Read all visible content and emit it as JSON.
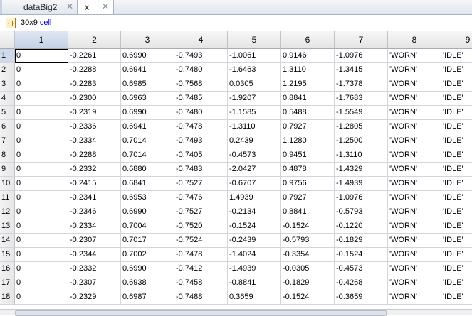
{
  "tabs": [
    {
      "label": "dataBig2",
      "close": "✕"
    },
    {
      "label": "x",
      "close": "✕"
    }
  ],
  "info": {
    "size": "30x9",
    "type": "cell"
  },
  "columns": [
    "1",
    "2",
    "3",
    "4",
    "5",
    "6",
    "7",
    "8",
    "9"
  ],
  "rows": [
    {
      "n": "1",
      "cells": [
        "0",
        "-0.2261",
        "0.6990",
        "-0.7493",
        "-1.0061",
        "0.9146",
        "-1.0976",
        "'WORN'",
        "'IDLE'"
      ]
    },
    {
      "n": "2",
      "cells": [
        "0",
        "-0.2288",
        "0.6941",
        "-0.7480",
        "-1.6463",
        "1.3110",
        "-1.3415",
        "'WORN'",
        "'IDLE'"
      ]
    },
    {
      "n": "3",
      "cells": [
        "0",
        "-0.2283",
        "0.6985",
        "-0.7568",
        "0.0305",
        "1.2195",
        "-1.7378",
        "'WORN'",
        "'IDLE'"
      ]
    },
    {
      "n": "4",
      "cells": [
        "0",
        "-0.2300",
        "0.6963",
        "-0.7485",
        "-1.9207",
        "0.8841",
        "-1.7683",
        "'WORN'",
        "'IDLE'"
      ]
    },
    {
      "n": "5",
      "cells": [
        "0",
        "-0.2319",
        "0.6990",
        "-0.7480",
        "-1.1585",
        "0.5488",
        "-1.5549",
        "'WORN'",
        "'IDLE'"
      ]
    },
    {
      "n": "6",
      "cells": [
        "0",
        "-0.2336",
        "0.6941",
        "-0.7478",
        "-1.3110",
        "0.7927",
        "-1.2805",
        "'WORN'",
        "'IDLE'"
      ]
    },
    {
      "n": "7",
      "cells": [
        "0",
        "-0.2334",
        "0.7014",
        "-0.7493",
        "0.2439",
        "1.1280",
        "-1.2500",
        "'WORN'",
        "'IDLE'"
      ]
    },
    {
      "n": "8",
      "cells": [
        "0",
        "-0.2288",
        "0.7014",
        "-0.7405",
        "-0.4573",
        "0.9451",
        "-1.3110",
        "'WORN'",
        "'IDLE'"
      ]
    },
    {
      "n": "9",
      "cells": [
        "0",
        "-0.2332",
        "0.6880",
        "-0.7483",
        "-2.0427",
        "0.4878",
        "-1.4329",
        "'WORN'",
        "'IDLE'"
      ]
    },
    {
      "n": "10",
      "cells": [
        "0",
        "-0.2415",
        "0.6841",
        "-0.7527",
        "-0.6707",
        "0.9756",
        "-1.4939",
        "'WORN'",
        "'IDLE'"
      ]
    },
    {
      "n": "11",
      "cells": [
        "0",
        "-0.2341",
        "0.6953",
        "-0.7476",
        "1.4939",
        "0.7927",
        "-1.0976",
        "'WORN'",
        "'IDLE'"
      ]
    },
    {
      "n": "12",
      "cells": [
        "0",
        "-0.2346",
        "0.6990",
        "-0.7527",
        "-0.2134",
        "0.8841",
        "-0.5793",
        "'WORN'",
        "'IDLE'"
      ]
    },
    {
      "n": "13",
      "cells": [
        "0",
        "-0.2334",
        "0.7004",
        "-0.7520",
        "-0.1524",
        "-0.1524",
        "-0.1220",
        "'WORN'",
        "'IDLE'"
      ]
    },
    {
      "n": "14",
      "cells": [
        "0",
        "-0.2307",
        "0.7017",
        "-0.7524",
        "-0.2439",
        "-0.5793",
        "-0.1829",
        "'WORN'",
        "'IDLE'"
      ]
    },
    {
      "n": "15",
      "cells": [
        "0",
        "-0.2344",
        "0.7002",
        "-0.7478",
        "-1.4024",
        "-0.3354",
        "-0.1524",
        "'WORN'",
        "'IDLE'"
      ]
    },
    {
      "n": "16",
      "cells": [
        "0",
        "-0.2332",
        "0.6990",
        "-0.7412",
        "-1.4939",
        "-0.0305",
        "-0.4573",
        "'WORN'",
        "'IDLE'"
      ]
    },
    {
      "n": "17",
      "cells": [
        "0",
        "-0.2307",
        "0.6938",
        "-0.7458",
        "-0.8841",
        "-0.1829",
        "-0.4268",
        "'WORN'",
        "'IDLE'"
      ]
    },
    {
      "n": "18",
      "cells": [
        "0",
        "-0.2329",
        "0.6987",
        "-0.7488",
        "0.3659",
        "-0.1524",
        "-0.3659",
        "'WORN'",
        "'IDLE'"
      ]
    }
  ],
  "colors": {
    "header_selected": "#c5d2e6",
    "link": "#0000ee",
    "grid_line": "#d2d6dc"
  }
}
